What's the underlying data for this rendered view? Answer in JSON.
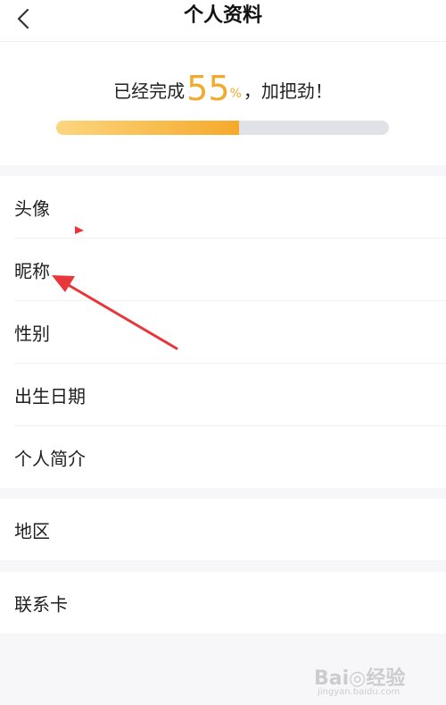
{
  "header": {
    "back_icon": "chevron-left-icon",
    "title": "个人资料"
  },
  "progress": {
    "prefix": "已经完成",
    "percent_number": "55",
    "percent_sign": "%",
    "suffix": "，加把劲！",
    "fraction": 0.55,
    "bar_color_start": "#fbd67f",
    "bar_color_end": "#f6a92a",
    "track_color": "#e1e2e8"
  },
  "profile_items": [
    {
      "label": "头像"
    },
    {
      "label": "昵称"
    },
    {
      "label": "性别"
    },
    {
      "label": "出生日期"
    },
    {
      "label": "个人简介"
    }
  ],
  "region_item": {
    "label": "地区"
  },
  "contact_item": {
    "label": "联系卡"
  },
  "watermark": {
    "brand": "Bai◎经验",
    "url": "jingyan.baidu.com"
  },
  "colors": {
    "accent": "#f2a92e",
    "annotation_arrow": "#e8363a"
  }
}
